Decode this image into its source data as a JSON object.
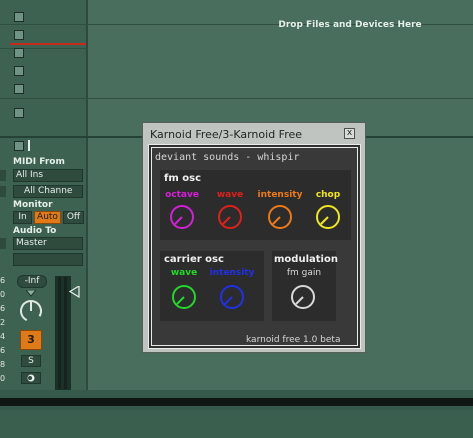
{
  "arrangement": {
    "drop_hint": "Drop Files and Devices Here"
  },
  "mixer": {
    "midi_from_label": "MIDI From",
    "midi_from_value": "All Ins",
    "midi_channel_value": "All Channe",
    "monitor_label": "Monitor",
    "monitor_in": "In",
    "monitor_auto": "Auto",
    "monitor_off": "Off",
    "audio_to_label": "Audio To",
    "audio_to_value": "Master",
    "volume_value": "-Inf",
    "track_number": "3",
    "solo_label": "S",
    "meter_scale": [
      "6",
      "0",
      "6",
      "2",
      "4",
      "6",
      "8",
      "0"
    ]
  },
  "plugin_window": {
    "title": "Karnoid Free/3-Karnoid Free",
    "close_label": "x",
    "header": "deviant sounds - whispir",
    "fm_osc": {
      "title": "fm osc",
      "knobs": [
        {
          "label": "octave",
          "color": "#d41fd8"
        },
        {
          "label": "wave",
          "color": "#e0201a"
        },
        {
          "label": "intensity",
          "color": "#ec7a16"
        },
        {
          "label": "chop",
          "color": "#f0e81a"
        }
      ]
    },
    "carrier_osc": {
      "title": "carrier osc",
      "knobs": [
        {
          "label": "wave",
          "color": "#22d82a"
        },
        {
          "label": "intensity",
          "color": "#2030e8"
        }
      ]
    },
    "modulation": {
      "title": "modulation",
      "knobs": [
        {
          "label": "fm gain",
          "color": "#d8d8d8"
        }
      ]
    },
    "footer": "karnoid free 1.0 beta"
  }
}
